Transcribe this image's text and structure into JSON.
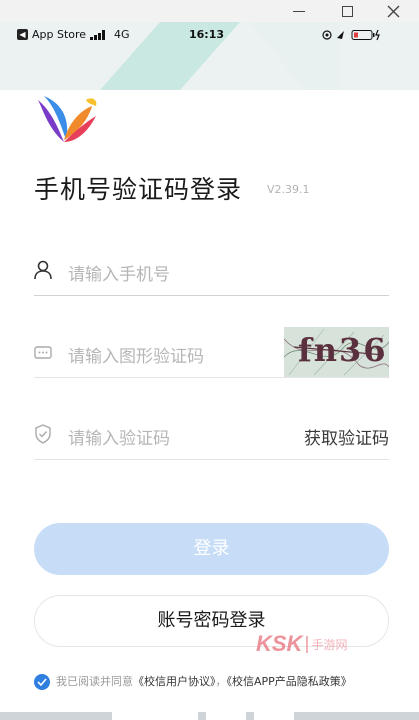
{
  "status_bar": {
    "carrier": "App Store",
    "network": "4G",
    "time": "16:13"
  },
  "login": {
    "title": "手机号验证码登录",
    "version": "V2.39.1",
    "phone_placeholder": "请输入手机号",
    "captcha_placeholder": "请输入图形验证码",
    "captcha_text": "fn36",
    "code_placeholder": "请输入验证码",
    "get_code_label": "获取验证码",
    "login_button": "登录",
    "password_login_button": "账号密码登录"
  },
  "agreement": {
    "prefix": "我已阅读并同意",
    "user_agreement": "《校信用户协议》",
    "separator": "，",
    "privacy_policy": "《校信APP产品隐私政策》",
    "checked": true
  },
  "watermark": {
    "brand": "KSK",
    "sub": "手游网"
  },
  "colors": {
    "accent": "#2f7fe0",
    "login_button_disabled": "#c7ddf7",
    "placeholder": "#b6b6b6"
  },
  "icons": [
    "close-icon",
    "maximize-icon",
    "minimize-icon",
    "user-icon",
    "captcha-icon",
    "shield-icon",
    "check-icon",
    "bird-logo-icon"
  ]
}
